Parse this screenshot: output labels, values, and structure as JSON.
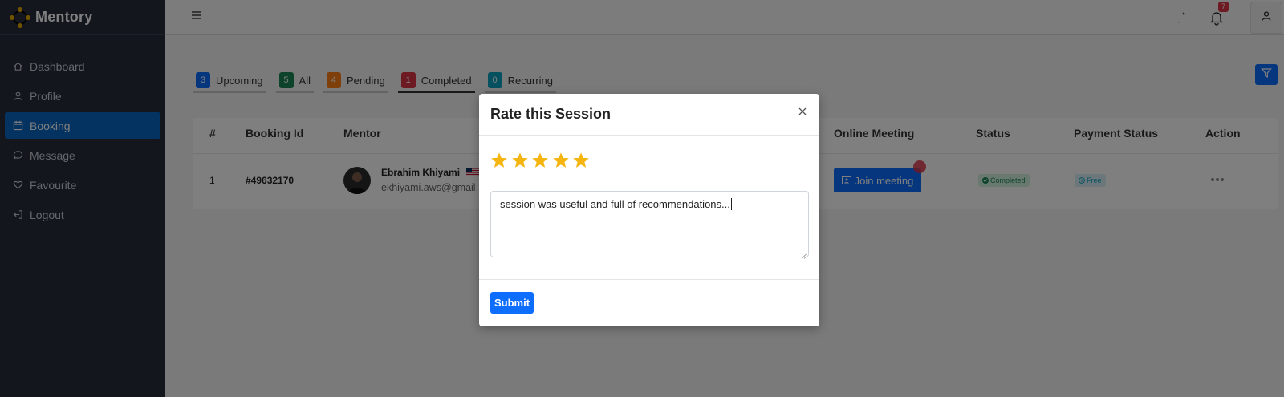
{
  "brand": {
    "name": "Mentory"
  },
  "sidebar": {
    "items": [
      {
        "label": "Dashboard",
        "icon": "home-icon"
      },
      {
        "label": "Profile",
        "icon": "user-icon"
      },
      {
        "label": "Booking",
        "icon": "calendar-icon",
        "active": true
      },
      {
        "label": "Message",
        "icon": "chat-icon"
      },
      {
        "label": "Favourite",
        "icon": "heart-icon"
      },
      {
        "label": "Logout",
        "icon": "logout-icon"
      }
    ]
  },
  "topbar": {
    "notification_count": "7"
  },
  "tabs": [
    {
      "count": "3",
      "label": "Upcoming",
      "color": "#0d6efd"
    },
    {
      "count": "5",
      "label": "All",
      "color": "#198754"
    },
    {
      "count": "4",
      "label": "Pending",
      "color": "#fd7e14"
    },
    {
      "count": "1",
      "label": "Completed",
      "color": "#dc3545",
      "active": true
    },
    {
      "count": "0",
      "label": "Recurring",
      "color": "#0aa2c0"
    }
  ],
  "table": {
    "headers": [
      "#",
      "Booking Id",
      "Mentor",
      "Online Meeting",
      "Status",
      "Payment Status",
      "Action"
    ],
    "row": {
      "index": "1",
      "booking_id": "#49632170",
      "mentor_name": "Ebrahim Khiyami",
      "mentor_email": "ekhiyami.aws@gmail.",
      "meeting_label": "Join meeting",
      "status": "Completed",
      "payment_status": "Free"
    }
  },
  "modal": {
    "title": "Rate this Session",
    "rating": 5,
    "max_rating": 5,
    "comment": "session was useful and full of recommendations...",
    "submit_label": "Submit"
  },
  "colors": {
    "primary": "#0d6efd",
    "sidebar_bg": "#262d3a",
    "star": "#f6b40e"
  }
}
